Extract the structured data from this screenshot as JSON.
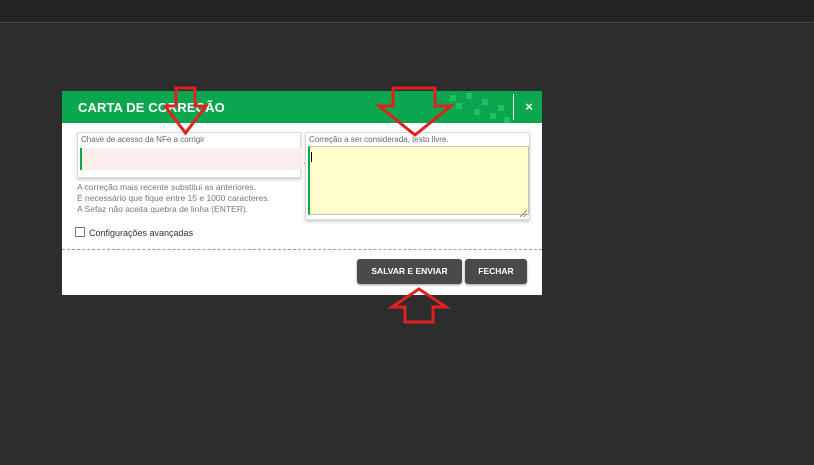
{
  "modal": {
    "title": "CARTA DE CORREÇÃO",
    "close_label": "×"
  },
  "key_field": {
    "label": "Chave de acesso da NFe a corrigir",
    "value": ""
  },
  "correction_field": {
    "label": "Correção a ser considerada, texto livre.",
    "value": ""
  },
  "help": {
    "lines": [
      "A correção mais recente substitui as anteriores.",
      "É necessário que fique entre 15 e 1000 caracteres.",
      "A Sefaz não aceita quebra de linha (ENTER)."
    ]
  },
  "advanced": {
    "label": "Configurações avançadas",
    "checked": false
  },
  "buttons": {
    "save_send": "SALVAR E ENVIAR",
    "close": "FECHAR"
  },
  "icons": {
    "warning": "warning-triangle-icon",
    "arrows": "annotation-arrow-icon"
  },
  "colors": {
    "header_green": "#0aa74e",
    "warning_red": "#e04646",
    "annotation_red": "#e32020",
    "button_gray": "#4a4a4a",
    "textarea_bg": "#ffffcc",
    "invalid_input_bg": "#fbeeea"
  }
}
